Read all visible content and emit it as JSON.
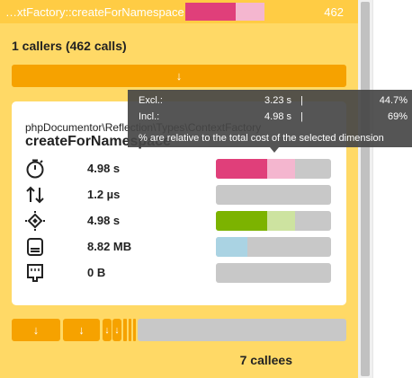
{
  "topbar": {
    "title": "…xtFactory::createForNamespace",
    "count": "462",
    "bar_excl_fraction": 0.636,
    "bar_colors": {
      "excl": "#e03f7a",
      "incl": "#f4b6cf"
    }
  },
  "callers_label": "1 callers (462 calls)",
  "arrow_glyph": "↓",
  "card": {
    "namespace": "phpDocumentor\\Reflection\\Types\\ContextFactory",
    "function": "createForNamespace",
    "metrics": [
      {
        "name": "time",
        "icon": "stopwatch-icon",
        "value": "4.98 s",
        "excl_fraction": 0.447,
        "incl_fraction": 0.69,
        "excl_color": "#e03f7a",
        "incl_color": "#f4b6cf"
      },
      {
        "name": "io",
        "icon": "up-down-arrows-icon",
        "value": "1.2 µs",
        "excl_fraction": 0,
        "incl_fraction": 0,
        "excl_color": "#e03f7a",
        "incl_color": "#f4b6cf"
      },
      {
        "name": "cpu",
        "icon": "cpu-chip-icon",
        "value": "4.98 s",
        "excl_fraction": 0.447,
        "incl_fraction": 0.69,
        "excl_color": "#7cb300",
        "incl_color": "#cde3a0"
      },
      {
        "name": "memory",
        "icon": "memory-icon",
        "value": "8.82 MB",
        "excl_fraction": 0.0,
        "incl_fraction": 0.27,
        "excl_color": "#5fa7c8",
        "incl_color": "#aad3e3"
      },
      {
        "name": "network",
        "icon": "network-port-icon",
        "value": "0 B",
        "excl_fraction": 0,
        "incl_fraction": 0,
        "excl_color": "#e03f7a",
        "incl_color": "#f4b6cf"
      }
    ]
  },
  "callees_label": "7 callees",
  "tooltip": {
    "excl_label": "Excl.:",
    "excl_value": "3.23 s",
    "excl_percent": "44.7%",
    "incl_label": "Incl.:",
    "incl_value": "4.98 s",
    "incl_percent": "69%",
    "separator": "|",
    "note": "% are relative to the total cost of the selected dimension"
  }
}
